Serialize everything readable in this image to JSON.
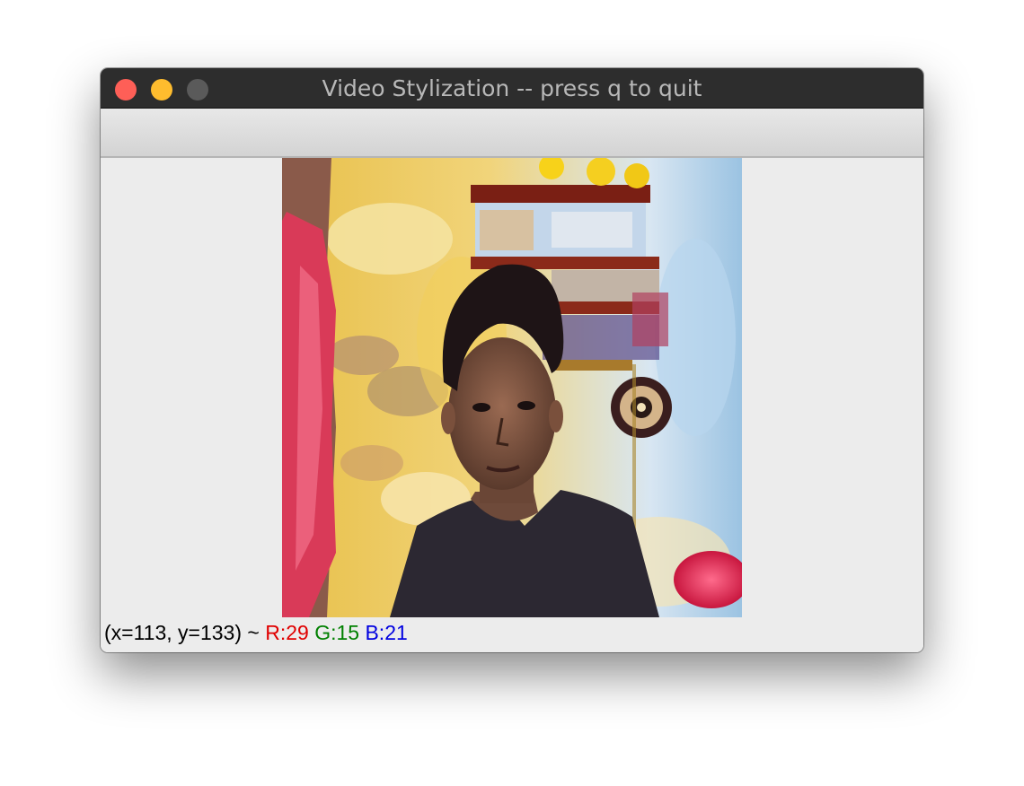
{
  "window": {
    "title": "Video Stylization -- press q to quit"
  },
  "traffic_lights": {
    "close_color": "#fe5f57",
    "minimize_color": "#febc2e",
    "zoom_color": "#5a5a5a"
  },
  "image": {
    "description_icon": "stylized-webcam-frame"
  },
  "status_bar": {
    "coords": "(x=113, y=133) ~",
    "r": "R:29",
    "g": "G:15",
    "b": "B:21"
  }
}
